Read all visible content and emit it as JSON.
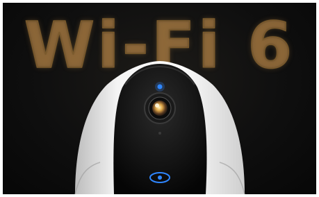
{
  "image": {
    "headline": "Wi-Fi 6",
    "subject": "security-camera",
    "colors": {
      "background": "#0b0b0b",
      "headline_outline": "#7a5a2c",
      "camera_shell": "#f2f2f2",
      "camera_face": "#141414",
      "status_led": "#2f86ff",
      "lens_glow": "#e0b060"
    }
  }
}
